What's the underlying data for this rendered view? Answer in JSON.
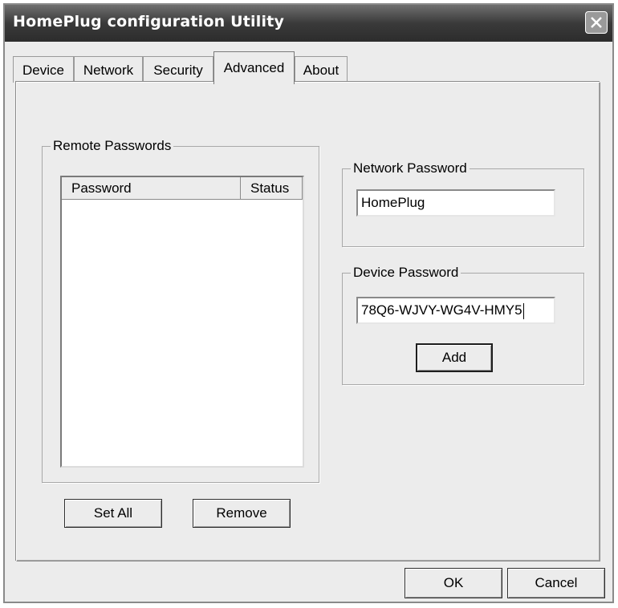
{
  "window": {
    "title": "HomePlug configuration Utility"
  },
  "tabs": [
    {
      "label": "Device"
    },
    {
      "label": "Network"
    },
    {
      "label": "Security"
    },
    {
      "label": "Advanced"
    },
    {
      "label": "About"
    }
  ],
  "active_tab": "Advanced",
  "remote_passwords": {
    "label": "Remote Passwords",
    "columns": [
      "Password",
      "Status"
    ],
    "rows": [],
    "set_all_label": "Set All",
    "remove_label": "Remove"
  },
  "network_password": {
    "label": "Network Password",
    "value": "HomePlug"
  },
  "device_password": {
    "label": "Device Password",
    "value": "78Q6-WJVY-WG4V-HMY5",
    "add_label": "Add"
  },
  "footer": {
    "ok_label": "OK",
    "cancel_label": "Cancel"
  },
  "icons": {
    "close": "close-icon"
  }
}
